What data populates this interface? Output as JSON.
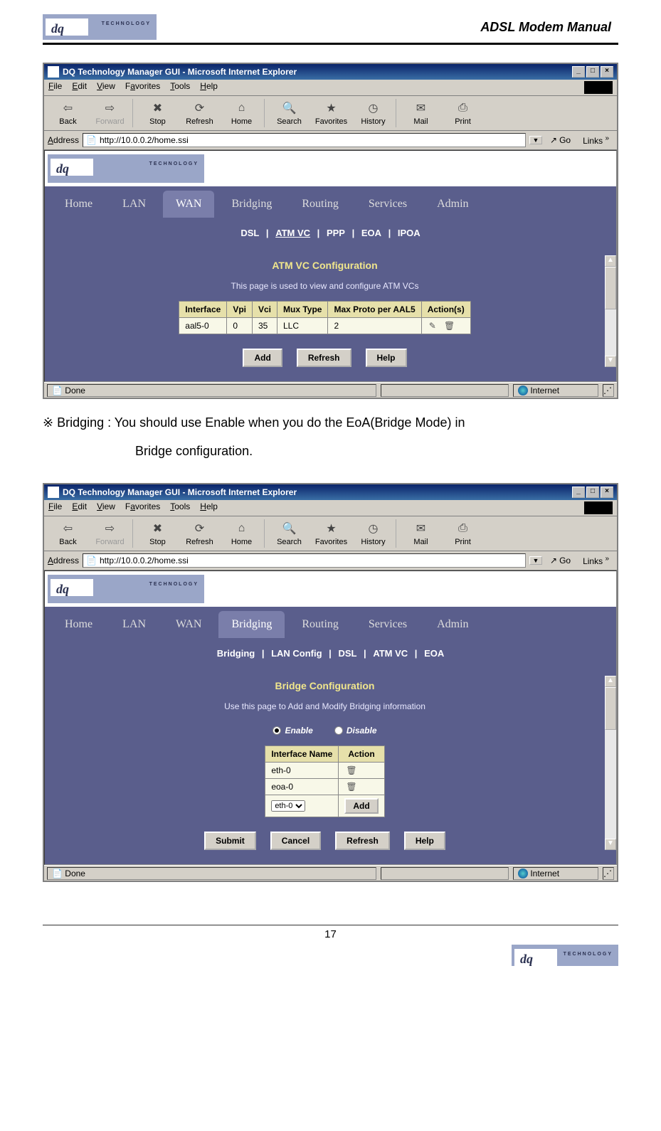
{
  "doc_header": {
    "title": "ADSL Modem Manual",
    "logo_text": "TECHNOLOGY",
    "logo_dq": "dq"
  },
  "manual_text": {
    "line1": "※ Bridging  : You should use Enable when you do the EoA(Bridge Mode) in",
    "line2": "Bridge configuration."
  },
  "browser_common": {
    "title": "DQ Technology Manager GUI - Microsoft Internet Explorer",
    "menu": {
      "file": "File",
      "edit": "Edit",
      "view": "View",
      "favorites": "Favorites",
      "tools": "Tools",
      "help": "Help"
    },
    "toolbar": {
      "back": "Back",
      "forward": "Forward",
      "stop": "Stop",
      "refresh": "Refresh",
      "home": "Home",
      "search": "Search",
      "favorites": "Favorites",
      "history": "History",
      "mail": "Mail",
      "print": "Print"
    },
    "address_label": "Address",
    "url": "http://10.0.0.2/home.ssi",
    "go": "Go",
    "links": "Links",
    "status_done": "Done",
    "status_zone": "Internet",
    "brand": "TECHNOLOGY",
    "tabs": {
      "home": "Home",
      "lan": "LAN",
      "wan": "WAN",
      "bridging": "Bridging",
      "routing": "Routing",
      "services": "Services",
      "admin": "Admin"
    }
  },
  "screenshot1": {
    "subnav": {
      "dsl": "DSL",
      "atm": "ATM VC",
      "ppp": "PPP",
      "eoa": "EOA",
      "ipoa": "IPOA"
    },
    "page_title": "ATM VC Configuration",
    "page_text": "This page is used to view and configure ATM VCs",
    "table": {
      "headers": {
        "iface": "Interface",
        "vpi": "Vpi",
        "vci": "Vci",
        "mux": "Mux Type",
        "max": "Max Proto per AAL5",
        "action": "Action(s)"
      },
      "row": {
        "iface": "aal5-0",
        "vpi": "0",
        "vci": "35",
        "mux": "LLC",
        "max": "2"
      }
    },
    "buttons": {
      "add": "Add",
      "refresh": "Refresh",
      "help": "Help"
    }
  },
  "screenshot2": {
    "subnav": {
      "bridging": "Bridging",
      "lanconfig": "LAN Config",
      "dsl": "DSL",
      "atm": "ATM VC",
      "eoa": "EOA"
    },
    "page_title": "Bridge Configuration",
    "page_text": "Use this page to Add and Modify Bridging information",
    "radio": {
      "enable": "Enable",
      "disable": "Disable"
    },
    "table": {
      "headers": {
        "name": "Interface Name",
        "action": "Action"
      },
      "rows": [
        {
          "name": "eth-0"
        },
        {
          "name": "eoa-0"
        }
      ],
      "select_option": "eth-0",
      "add": "Add"
    },
    "buttons": {
      "submit": "Submit",
      "cancel": "Cancel",
      "refresh": "Refresh",
      "help": "Help"
    }
  },
  "footer": {
    "page_number": "17"
  }
}
